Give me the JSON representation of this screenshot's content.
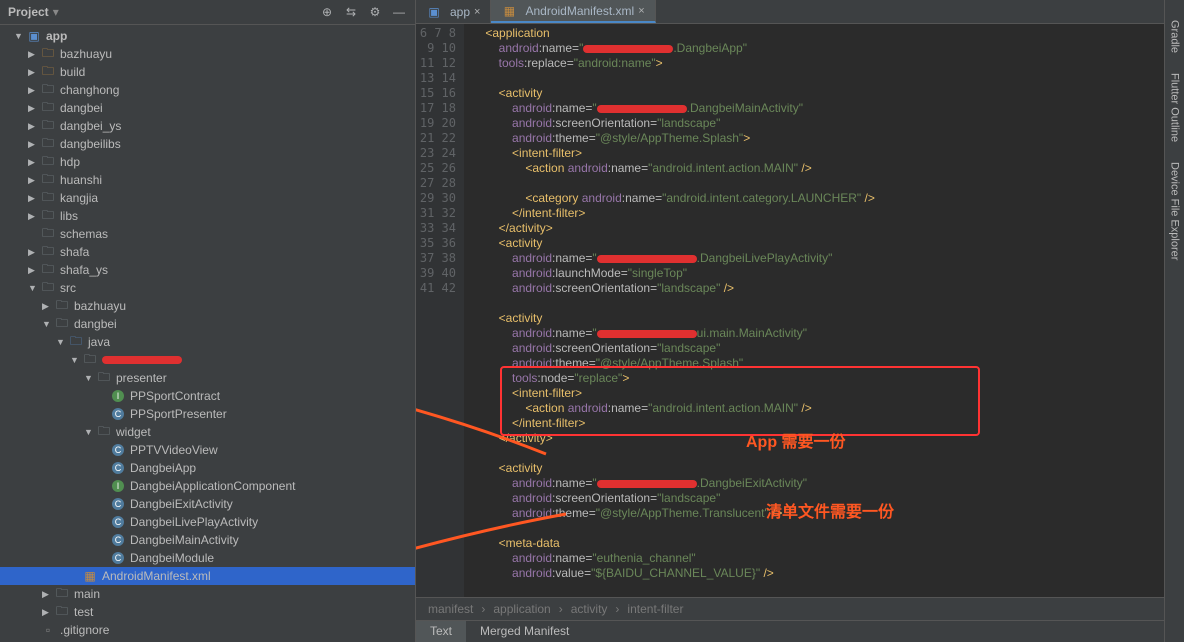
{
  "sidebar": {
    "title": "Project",
    "items": [
      {
        "indent": 1,
        "arrow": "▼",
        "icon": "module",
        "label": "app",
        "bold": true
      },
      {
        "indent": 2,
        "arrow": "▶",
        "icon": "folder-orange",
        "label": "bazhuayu"
      },
      {
        "indent": 2,
        "arrow": "▶",
        "icon": "folder-orange",
        "label": "build"
      },
      {
        "indent": 2,
        "arrow": "▶",
        "icon": "folder",
        "label": "changhong"
      },
      {
        "indent": 2,
        "arrow": "▶",
        "icon": "folder",
        "label": "dangbei"
      },
      {
        "indent": 2,
        "arrow": "▶",
        "icon": "folder",
        "label": "dangbei_ys"
      },
      {
        "indent": 2,
        "arrow": "▶",
        "icon": "folder",
        "label": "dangbeilibs"
      },
      {
        "indent": 2,
        "arrow": "▶",
        "icon": "folder",
        "label": "hdp"
      },
      {
        "indent": 2,
        "arrow": "▶",
        "icon": "folder",
        "label": "huanshi"
      },
      {
        "indent": 2,
        "arrow": "▶",
        "icon": "folder",
        "label": "kangjia"
      },
      {
        "indent": 2,
        "arrow": "▶",
        "icon": "folder",
        "label": "libs"
      },
      {
        "indent": 2,
        "arrow": "",
        "icon": "folder",
        "label": "schemas"
      },
      {
        "indent": 2,
        "arrow": "▶",
        "icon": "folder",
        "label": "shafa"
      },
      {
        "indent": 2,
        "arrow": "▶",
        "icon": "folder",
        "label": "shafa_ys"
      },
      {
        "indent": 2,
        "arrow": "▼",
        "icon": "folder",
        "label": "src"
      },
      {
        "indent": 3,
        "arrow": "▶",
        "icon": "folder",
        "label": "bazhuayu"
      },
      {
        "indent": 3,
        "arrow": "▼",
        "icon": "folder",
        "label": "dangbei"
      },
      {
        "indent": 4,
        "arrow": "▼",
        "icon": "folder-blue",
        "label": "java"
      },
      {
        "indent": 5,
        "arrow": "▼",
        "icon": "folder",
        "label": "",
        "redact": 80
      },
      {
        "indent": 6,
        "arrow": "▼",
        "icon": "folder",
        "label": "presenter"
      },
      {
        "indent": 7,
        "arrow": "",
        "icon": "class-green",
        "label": "PPSportContract"
      },
      {
        "indent": 7,
        "arrow": "",
        "icon": "class",
        "label": "PPSportPresenter"
      },
      {
        "indent": 6,
        "arrow": "▼",
        "icon": "folder",
        "label": "widget"
      },
      {
        "indent": 7,
        "arrow": "",
        "icon": "class",
        "label": "PPTVVideoView"
      },
      {
        "indent": 7,
        "arrow": "",
        "icon": "class",
        "label": "DangbeiApp"
      },
      {
        "indent": 7,
        "arrow": "",
        "icon": "class-green",
        "label": "DangbeiApplicationComponent"
      },
      {
        "indent": 7,
        "arrow": "",
        "icon": "class",
        "label": "DangbeiExitActivity"
      },
      {
        "indent": 7,
        "arrow": "",
        "icon": "class",
        "label": "DangbeiLivePlayActivity"
      },
      {
        "indent": 7,
        "arrow": "",
        "icon": "class",
        "label": "DangbeiMainActivity"
      },
      {
        "indent": 7,
        "arrow": "",
        "icon": "class",
        "label": "DangbeiModule"
      },
      {
        "indent": 5,
        "arrow": "",
        "icon": "xml",
        "label": "AndroidManifest.xml",
        "selected": true
      },
      {
        "indent": 3,
        "arrow": "▶",
        "icon": "folder",
        "label": "main"
      },
      {
        "indent": 3,
        "arrow": "▶",
        "icon": "folder",
        "label": "test"
      },
      {
        "indent": 2,
        "arrow": "",
        "icon": "file",
        "label": ".gitignore"
      }
    ]
  },
  "tabs": [
    {
      "icon": "module",
      "label": "app"
    },
    {
      "icon": "xml",
      "label": "AndroidManifest.xml",
      "active": true
    }
  ],
  "gutter_start": 6,
  "gutter_end": 42,
  "breadcrumb": [
    "manifest",
    "application",
    "activity",
    "intent-filter"
  ],
  "bottom_tabs": [
    {
      "label": "Text",
      "active": true
    },
    {
      "label": "Merged Manifest"
    }
  ],
  "rail": [
    "Gradle",
    "Flutter Outline",
    "Device File Explorer"
  ],
  "annotations": {
    "app_note": "App 需要一份",
    "manifest_note": "清单文件需要一份"
  },
  "code_lines": [
    {
      "i": 2,
      "h": "<span class='tag'>&lt;application</span>"
    },
    {
      "i": 4,
      "h": "<span class='attr-ns'>android</span><span class='attr'>:name=</span><span class='str'>\"</span><span class='redact' style='width:90px'></span><span class='str'>.DangbeiApp\"</span>"
    },
    {
      "i": 4,
      "h": "<span class='attr-ns'>tools</span><span class='attr'>:replace=</span><span class='str'>\"android:name\"</span><span class='tag'>&gt;</span>"
    },
    {
      "i": 0,
      "h": ""
    },
    {
      "i": 4,
      "h": "<span class='tag'>&lt;activity</span>"
    },
    {
      "i": 6,
      "h": "<span class='attr-ns'>android</span><span class='attr'>:name=</span><span class='str'>\"</span><span class='redact' style='width:90px'></span><span class='str'>.DangbeiMainActivity\"</span>"
    },
    {
      "i": 6,
      "h": "<span class='attr-ns'>android</span><span class='attr'>:screenOrientation=</span><span class='str'>\"landscape\"</span>"
    },
    {
      "i": 6,
      "h": "<span class='attr-ns'>android</span><span class='attr'>:theme=</span><span class='str'>\"@style/AppTheme.Splash\"</span><span class='tag'>&gt;</span>"
    },
    {
      "i": 6,
      "h": "<span class='tag'>&lt;intent-filter&gt;</span>"
    },
    {
      "i": 8,
      "h": "<span class='tag'>&lt;action</span> <span class='attr-ns'>android</span><span class='attr'>:name=</span><span class='str'>\"android.intent.action.MAIN\"</span> <span class='tag'>/&gt;</span>"
    },
    {
      "i": 0,
      "h": ""
    },
    {
      "i": 8,
      "h": "<span class='tag'>&lt;category</span> <span class='attr-ns'>android</span><span class='attr'>:name=</span><span class='str'>\"android.intent.category.LAUNCHER\"</span> <span class='tag'>/&gt;</span>"
    },
    {
      "i": 6,
      "h": "<span class='tag'>&lt;/intent-filter&gt;</span>"
    },
    {
      "i": 4,
      "h": "<span class='tag'>&lt;/activity&gt;</span>"
    },
    {
      "i": 4,
      "h": "<span class='tag'>&lt;activity</span>"
    },
    {
      "i": 6,
      "h": "<span class='attr-ns'>android</span><span class='attr'>:name=</span><span class='str'>\"</span><span class='redact' style='width:100px'></span><span class='str'>.DangbeiLivePlayActivity\"</span>"
    },
    {
      "i": 6,
      "h": "<span class='attr-ns'>android</span><span class='attr'>:launchMode=</span><span class='str'>\"singleTop\"</span>"
    },
    {
      "i": 6,
      "h": "<span class='attr-ns'>android</span><span class='attr'>:screenOrientation=</span><span class='str'>\"landscape\"</span> <span class='tag'>/&gt;</span>"
    },
    {
      "i": 0,
      "h": ""
    },
    {
      "i": 4,
      "h": "<span class='tag'>&lt;activity</span>"
    },
    {
      "i": 6,
      "h": "<span class='attr-ns'>android</span><span class='attr'>:name=</span><span class='str'>\"</span><span class='redact' style='width:100px'></span><span class='str'>ui.main.MainActivity\"</span>"
    },
    {
      "i": 6,
      "h": "<span class='attr-ns'>android</span><span class='attr'>:screenOrientation=</span><span class='str'>\"landscape\"</span>"
    },
    {
      "i": 6,
      "h": "<span class='attr-ns'>android</span><span class='attr'>:theme=</span><span class='str'>\"@style/AppTheme.Splash\"</span>"
    },
    {
      "i": 6,
      "h": "<span class='attr-ns'>tools</span><span class='attr'>:node=</span><span class='str'>\"replace\"</span><span class='tag'>&gt;</span>"
    },
    {
      "i": 6,
      "h": "<span class='tag'>&lt;intent-filter&gt;</span>"
    },
    {
      "i": 8,
      "h": "<span class='tag'>&lt;action</span> <span class='attr-ns'>android</span><span class='attr'>:name=</span><span class='str'>\"android.intent.action.MAIN\"</span> <span class='tag'>/&gt;</span>"
    },
    {
      "i": 6,
      "h": "<span class='tag'>&lt;/intent-filter&gt;</span>"
    },
    {
      "i": 4,
      "h": "<span class='tag'>&lt;/activity&gt;</span>"
    },
    {
      "i": 0,
      "h": ""
    },
    {
      "i": 4,
      "h": "<span class='tag'>&lt;activity</span>"
    },
    {
      "i": 6,
      "h": "<span class='attr-ns'>android</span><span class='attr'>:name=</span><span class='str'>\"</span><span class='redact' style='width:100px'></span><span class='str'>.DangbeiExitActivity\"</span>"
    },
    {
      "i": 6,
      "h": "<span class='attr-ns'>android</span><span class='attr'>:screenOrientation=</span><span class='str'>\"landscape\"</span>"
    },
    {
      "i": 6,
      "h": "<span class='attr-ns'>android</span><span class='attr'>:theme=</span><span class='str'>\"@style/AppTheme.Translucent\"</span> <span class='tag'>/&gt;</span>"
    },
    {
      "i": 0,
      "h": ""
    },
    {
      "i": 4,
      "h": "<span class='tag'>&lt;meta-data</span>"
    },
    {
      "i": 6,
      "h": "<span class='attr-ns'>android</span><span class='attr'>:name=</span><span class='str'>\"euthenia_channel\"</span>"
    },
    {
      "i": 6,
      "h": "<span class='attr-ns'>android</span><span class='attr'>:value=</span><span class='str'>\"${BAIDU_CHANNEL_VALUE}\"</span> <span class='tag'>/&gt;</span>"
    }
  ]
}
